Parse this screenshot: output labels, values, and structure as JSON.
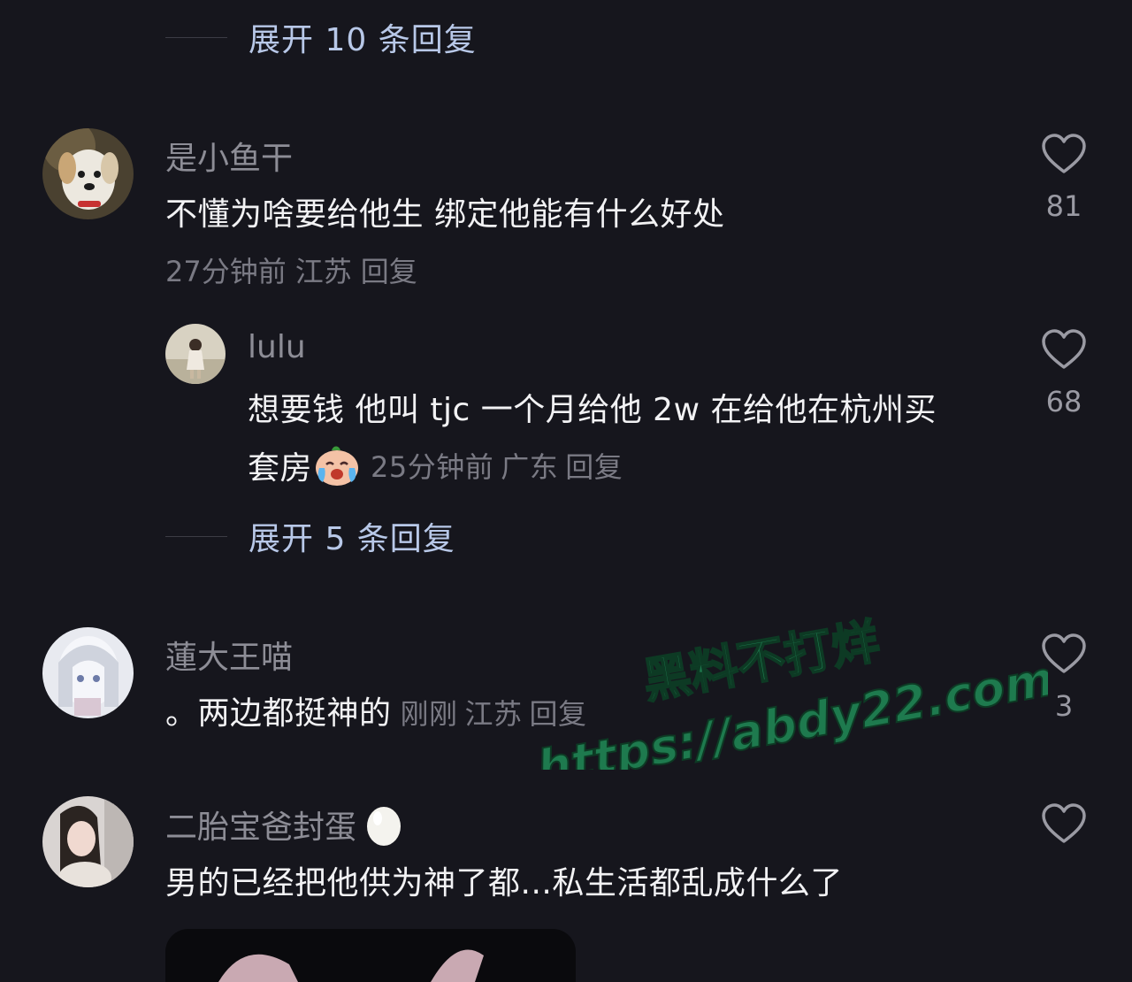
{
  "colors": {
    "background": "#16161d",
    "expand_text": "#b8c8e8",
    "watermark": "#1e7a4e"
  },
  "expand_top": {
    "label": "展开 10 条回复"
  },
  "comments": [
    {
      "username": "是小鱼干",
      "text": "不懂为啥要给他生  绑定他能有什么好处",
      "time": "27分钟前",
      "location": "江苏",
      "reply_label": "回复",
      "likes": "81",
      "avatar_icon": "dog-avatar"
    },
    {
      "username": "lulu",
      "text_line1": "想要钱 他叫 tjc 一个月给他 2w 在给他在杭州买",
      "text_line2": "套房",
      "emoji_icon": "crying-face-emoji",
      "time": "25分钟前",
      "location": "广东",
      "reply_label": "回复",
      "likes": "68",
      "avatar_icon": "girl-photo-avatar"
    },
    {
      "username": "蓮大王喵",
      "text": "。两边都挺神的",
      "time": "刚刚",
      "location": "江苏",
      "reply_label": "回复",
      "likes": "3",
      "avatar_icon": "anime-girl-avatar"
    },
    {
      "username": "二胎宝爸封蛋",
      "username_emoji": "egg-emoji",
      "text": "男的已经把他供为神了都...私生活都乱成什么了",
      "avatar_icon": "woman-photo-avatar"
    }
  ],
  "expand_mid": {
    "label": "展开 5 条回复"
  },
  "watermark": {
    "line1": "黑料不打烊",
    "line2": "https://abdy22.com"
  }
}
